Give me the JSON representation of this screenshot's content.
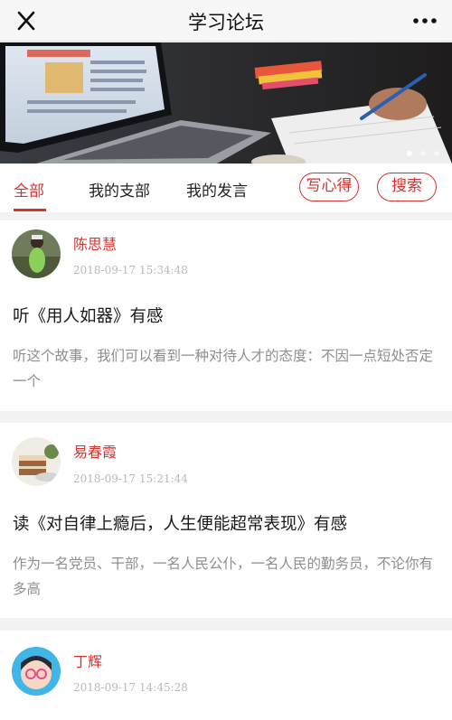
{
  "header": {
    "title": "学习论坛",
    "close_icon": "close-icon",
    "more_icon": "more-horizontal-icon"
  },
  "banner": {
    "slide_count": 3,
    "active_slide": 1
  },
  "tabs": {
    "items": [
      "全部",
      "我的支部",
      "我的发言"
    ],
    "active_index": 0,
    "write_label": "写心得",
    "search_label": "搜索"
  },
  "posts": [
    {
      "author": "陈思慧",
      "time": "2018-09-17 15:34:48",
      "title": "听《用人如器》有感",
      "excerpt": "听这个故事，我们可以看到一种对待人才的态度：不因一点短处否定一个"
    },
    {
      "author": "易春霞",
      "time": "2018-09-17 15:21:44",
      "title": "读《对自律上瘾后，人生便能超常表现》有感",
      "excerpt": "作为一名党员、干部，一名人民公仆，一名人民的勤务员，不论你有多高"
    },
    {
      "author": "丁辉",
      "time": "2018-09-17 14:45:28",
      "title": "",
      "excerpt": ""
    }
  ],
  "colors": {
    "accent": "#d9322f",
    "muted": "#8e8e8e",
    "timestamp": "#b9b9b9",
    "page_bg": "#f2f2f2"
  }
}
